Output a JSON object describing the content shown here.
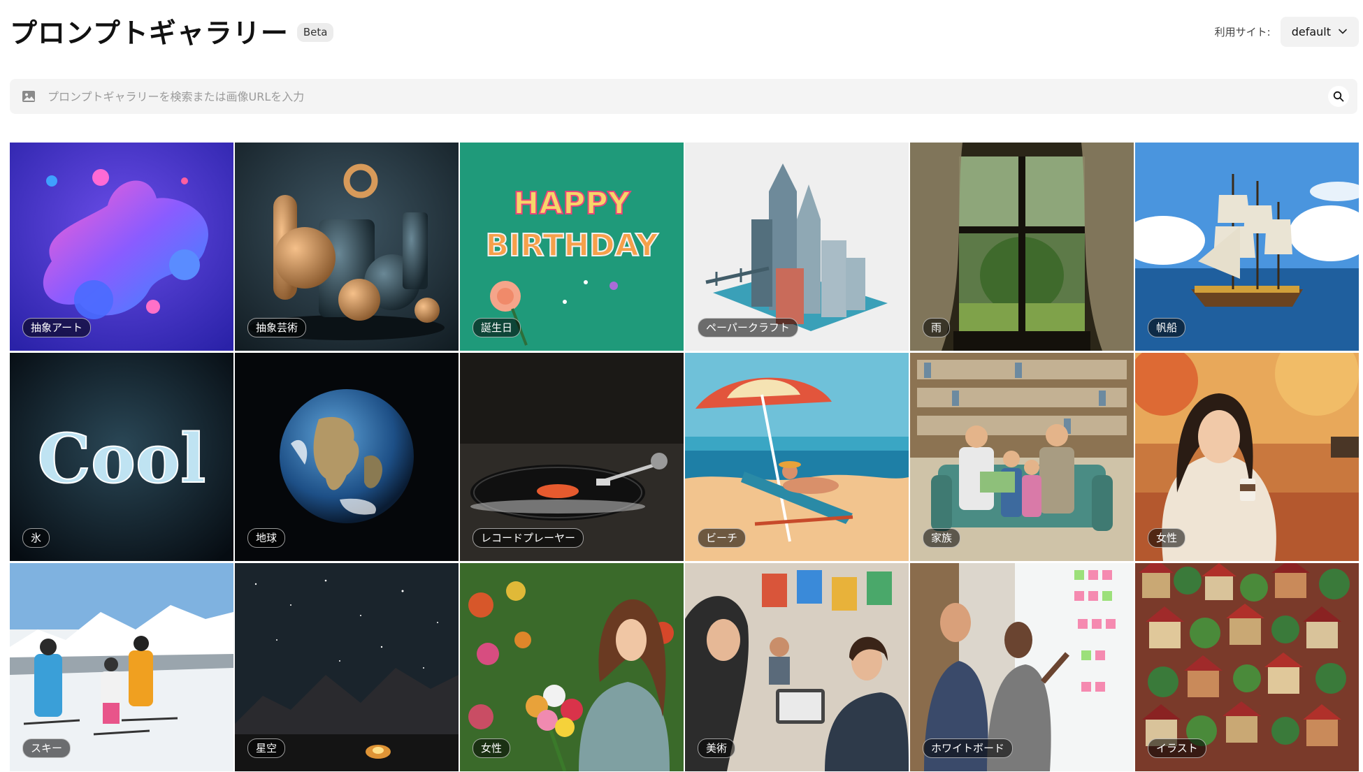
{
  "header": {
    "title": "プロンプトギャラリー",
    "badge": "Beta",
    "site_label": "利用サイト:",
    "site_value": "default"
  },
  "search": {
    "placeholder": "プロンプトギャラリーを検索または画像URLを入力",
    "value": ""
  },
  "icons": {
    "image": "image-icon",
    "search": "search-icon",
    "chevron": "chevron-down-icon"
  },
  "tiles": [
    {
      "label": "抽象アート"
    },
    {
      "label": "抽象芸術"
    },
    {
      "label": "誕生日"
    },
    {
      "label": "ペーパークラフト"
    },
    {
      "label": "雨"
    },
    {
      "label": "帆船"
    },
    {
      "label": "氷"
    },
    {
      "label": "地球"
    },
    {
      "label": "レコードプレーヤー"
    },
    {
      "label": "ビーチ"
    },
    {
      "label": "家族"
    },
    {
      "label": "女性"
    },
    {
      "label": "スキー"
    },
    {
      "label": "星空"
    },
    {
      "label": "女性"
    },
    {
      "label": "美術"
    },
    {
      "label": "ホワイトボード"
    },
    {
      "label": "イラスト"
    }
  ],
  "art_text": {
    "birthday_line1": "HAPPY",
    "birthday_line2": "BIRTHDAY",
    "cool": "Cool"
  }
}
